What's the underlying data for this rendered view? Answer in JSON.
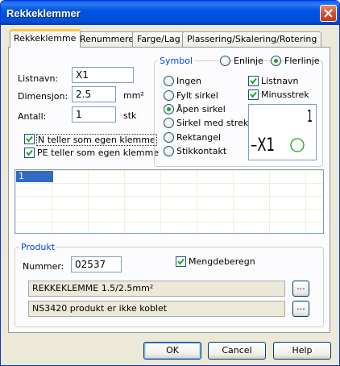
{
  "window": {
    "title": "Rekkeklemmer"
  },
  "tabs": [
    {
      "label": "Rekkeklemme",
      "active": true
    },
    {
      "label": "Renummerer",
      "active": false
    },
    {
      "label": "Farge/Lag",
      "active": false
    },
    {
      "label": "Plassering/Skalering/Rotering",
      "active": false
    }
  ],
  "fields": {
    "listnavn": {
      "label": "Listnavn:",
      "value": "X1"
    },
    "dimensjon": {
      "label": "Dimensjon:",
      "value": "2.5",
      "unit": "mm²"
    },
    "antall": {
      "label": "Antall:",
      "value": "1",
      "unit": "stk"
    }
  },
  "options": {
    "n_teller": {
      "label": "N teller som egen klemme",
      "checked": true
    },
    "pe_teller": {
      "label": "PE teller som egen klemme",
      "checked": true
    }
  },
  "symbol": {
    "title": "Symbol",
    "line_modes": [
      {
        "label": "Enlinje",
        "selected": false
      },
      {
        "label": "Flerlinje",
        "selected": true
      }
    ],
    "types": [
      {
        "label": "Ingen",
        "selected": false
      },
      {
        "label": "Fylt sirkel",
        "selected": false
      },
      {
        "label": "Åpen sirkel",
        "selected": true
      },
      {
        "label": "Sirkel med strek",
        "selected": false
      },
      {
        "label": "Rektangel",
        "selected": false
      },
      {
        "label": "Stikkontakt",
        "selected": false
      }
    ],
    "show_listnavn": {
      "label": "Listnavn",
      "checked": true
    },
    "show_minusstrek": {
      "label": "Minusstrek",
      "checked": true
    },
    "preview": {
      "top_text": "1",
      "bottom_text": "–X1"
    }
  },
  "list": {
    "items": [
      "1"
    ]
  },
  "produkt": {
    "title": "Produkt",
    "nummer": {
      "label": "Nummer:",
      "value": "02537"
    },
    "mengdeberegn": {
      "label": "Mengdeberegn",
      "checked": true
    },
    "description": "REKKEKLEMME   1.5/2.5mm²",
    "ns3420": "NS3420 produkt er ikke koblet",
    "browse_label": "..."
  },
  "buttons": {
    "ok": "OK",
    "cancel": "Cancel",
    "help": "Help"
  },
  "colors": {
    "accent": "#0054e3",
    "check": "#21a121",
    "group_title": "#0046d5"
  }
}
